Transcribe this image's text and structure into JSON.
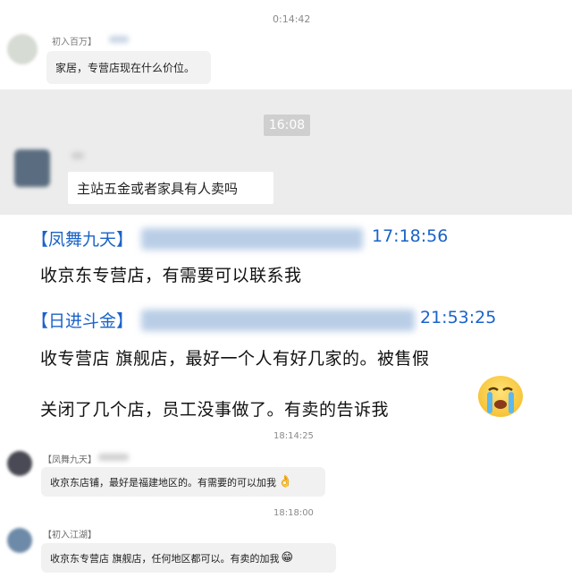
{
  "chat": {
    "msg1": {
      "timestamp": "0:14:42",
      "sender": "初入百万】",
      "text": "家居，专营店现在什么价位。"
    },
    "msg2": {
      "time_divider": "16:08",
      "text": "主站五金或者家具有人卖吗"
    },
    "msg3": {
      "sender": "【凤舞九天】",
      "time": "17:18:56",
      "text": "收京东专营店，有需要可以联系我"
    },
    "msg4": {
      "sender": "【日进斗金】",
      "time": "21:53:25",
      "line1": "收专营店  旗舰店，最好一个人有好几家的。被售假",
      "line2": "关闭了几个店，员工没事做了。有卖的告诉我",
      "emoji_icon": "crying-face-icon"
    },
    "msg5": {
      "timestamp": "18:14:25",
      "sender": "【凤舞九天】",
      "text": "收京东店铺，最好是福建地区的。有需要的可以加我",
      "emoji_icon": "ok-hand-icon"
    },
    "msg6": {
      "timestamp": "18:18:00",
      "sender": "【初入江湖】",
      "text": "收京东专营店  旗舰店，任何地区都可以。有卖的加我",
      "emoji_icon": "grinning-face-icon"
    }
  },
  "colors": {
    "sender_blue": "#1a63c9",
    "divider_band": "#ececec"
  }
}
